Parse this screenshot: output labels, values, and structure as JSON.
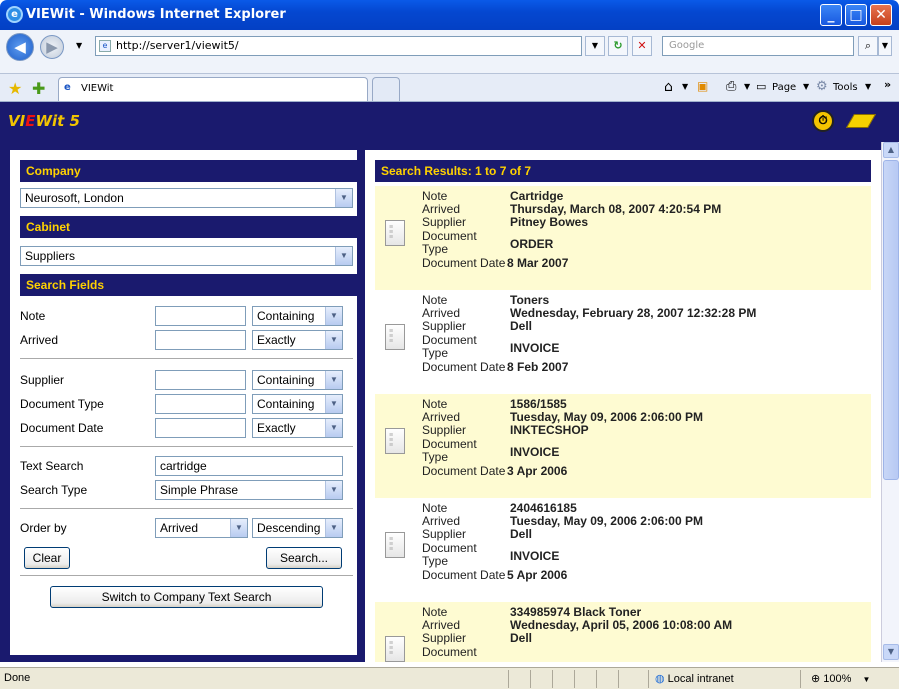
{
  "window": {
    "title": "VIEWit - Windows Internet Explorer"
  },
  "address": {
    "url": "http://server1/viewit5/",
    "search_placeholder": "Google"
  },
  "tab": {
    "label": "VIEWit"
  },
  "toolbar": {
    "page_label": "Page",
    "tools_label": "Tools"
  },
  "app": {
    "logo_a": "VI",
    "logo_b": "E",
    "logo_c": "Wit 5"
  },
  "left": {
    "company_header": "Company",
    "company_value": "Neurosoft, London",
    "cabinet_header": "Cabinet",
    "cabinet_value": "Suppliers",
    "fields_header": "Search Fields",
    "fields": [
      {
        "label": "Note",
        "match": "Containing"
      },
      {
        "label": "Arrived",
        "match": "Exactly"
      },
      {
        "label": "Supplier",
        "match": "Containing"
      },
      {
        "label": "Document Type",
        "match": "Containing"
      },
      {
        "label": "Document Date",
        "match": "Exactly"
      }
    ],
    "text_search_label": "Text Search",
    "text_search_value": "cartridge",
    "search_type_label": "Search Type",
    "search_type_value": "Simple Phrase",
    "order_by_label": "Order by",
    "order_by_value": "Arrived",
    "order_dir_value": "Descending",
    "clear_label": "Clear",
    "search_label": "Search...",
    "switch_label": "Switch to Company Text Search"
  },
  "results": {
    "header": "Search Results: 1 to 7 of 7",
    "keys": {
      "note": "Note",
      "arrived": "Arrived",
      "supplier": "Supplier",
      "doctype_a": "Document",
      "doctype_b": "Type",
      "docdate": "Document Date"
    },
    "items": [
      {
        "note": "Cartridge",
        "arrived": "Thursday, March 08, 2007 4:20:54 PM",
        "supplier": "Pitney Bowes",
        "doctype": "ORDER",
        "docdate": "8 Mar 2007"
      },
      {
        "note": "Toners",
        "arrived": "Wednesday, February 28, 2007 12:32:28 PM",
        "supplier": "Dell",
        "doctype": "INVOICE",
        "docdate": "8 Feb 2007"
      },
      {
        "note": "1586/1585",
        "arrived": "Tuesday, May 09, 2006 2:06:00 PM",
        "supplier": "INKTECSHOP",
        "doctype": "INVOICE",
        "docdate": "3 Apr 2006"
      },
      {
        "note": "2404616185",
        "arrived": "Tuesday, May 09, 2006 2:06:00 PM",
        "supplier": "Dell",
        "doctype": "INVOICE",
        "docdate": "5 Apr 2006"
      },
      {
        "note": "334985974 Black Toner",
        "arrived": "Wednesday, April 05, 2006 10:08:00 AM",
        "supplier": "Dell",
        "doctype": "",
        "docdate": ""
      }
    ]
  },
  "status": {
    "text": "Done",
    "zone": "Local intranet",
    "zoom": "100%"
  }
}
